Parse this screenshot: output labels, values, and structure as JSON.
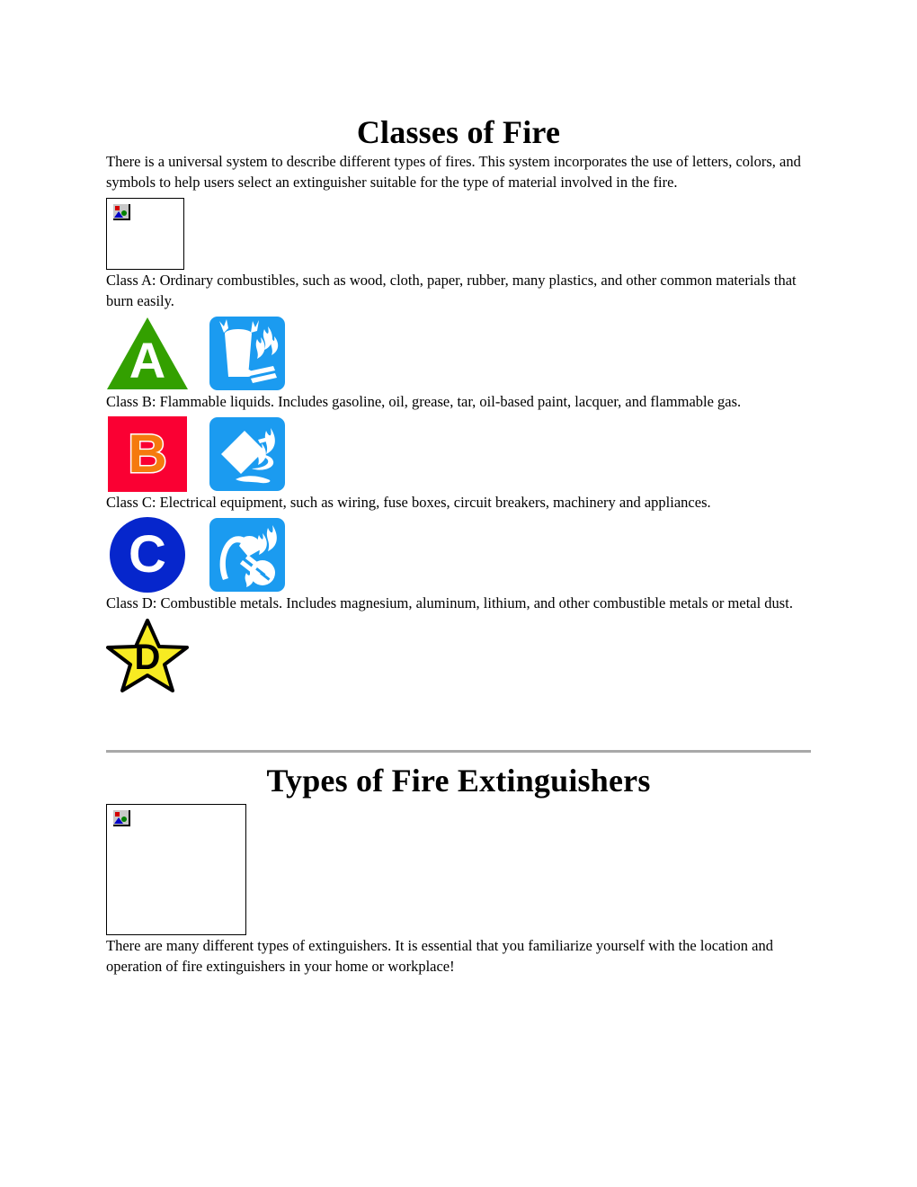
{
  "document": {
    "section1": {
      "title": "Classes of Fire",
      "intro": "There is a universal system to describe different types of fires. This system incorporates the use of letters, colors, and symbols to help users select an extinguisher suitable for the type of material involved in the fire.",
      "placeholder_image": {
        "alt": "broken-image-placeholder",
        "state": "missing"
      },
      "classes": [
        {
          "id": "class-a",
          "description": "Class A: Ordinary combustibles, such as wood, cloth, paper, rubber, many plastics, and other common materials that burn easily.",
          "letter": "A",
          "shape": "triangle",
          "shape_color": "#33A000",
          "letter_color": "#FFFFFF",
          "pictogram": "water-bucket-and-burning-wood-icon",
          "pictogram_bg": "#1B9BF0"
        },
        {
          "id": "class-b",
          "description": "Class B: Flammable liquids. Includes gasoline, oil, grease, tar, oil-based paint, lacquer, and flammable gas.",
          "letter": "B",
          "shape": "square",
          "shape_color": "#FA0033",
          "letter_color": "#F57A0E",
          "pictogram": "fuel-can-pouring-on-fire-icon",
          "pictogram_bg": "#1B9BF0"
        },
        {
          "id": "class-c",
          "description": "Class C: Electrical equipment, such as wiring, fuse boxes, circuit breakers, machinery and appliances.",
          "letter": "C",
          "shape": "circle",
          "shape_color": "#0626CC",
          "letter_color": "#FFFFFF",
          "pictogram": "electrical-plug-and-fire-icon",
          "pictogram_bg": "#1B9BF0"
        },
        {
          "id": "class-d",
          "description": "Class D: Combustible metals. Includes magnesium, aluminum, lithium, and other combustible metals or metal dust.",
          "letter": "D",
          "shape": "star",
          "shape_color": "#F7EB22",
          "letter_color": "#000000",
          "pictogram": null,
          "pictogram_bg": null
        }
      ]
    },
    "section2": {
      "title": "Types of Fire Extinguishers",
      "placeholder_image": {
        "alt": "broken-image-placeholder",
        "state": "missing"
      },
      "closing": "There are many different types of extinguishers. It is essential that you familiarize yourself with the location and operation of fire extinguishers in your home or workplace!"
    }
  }
}
